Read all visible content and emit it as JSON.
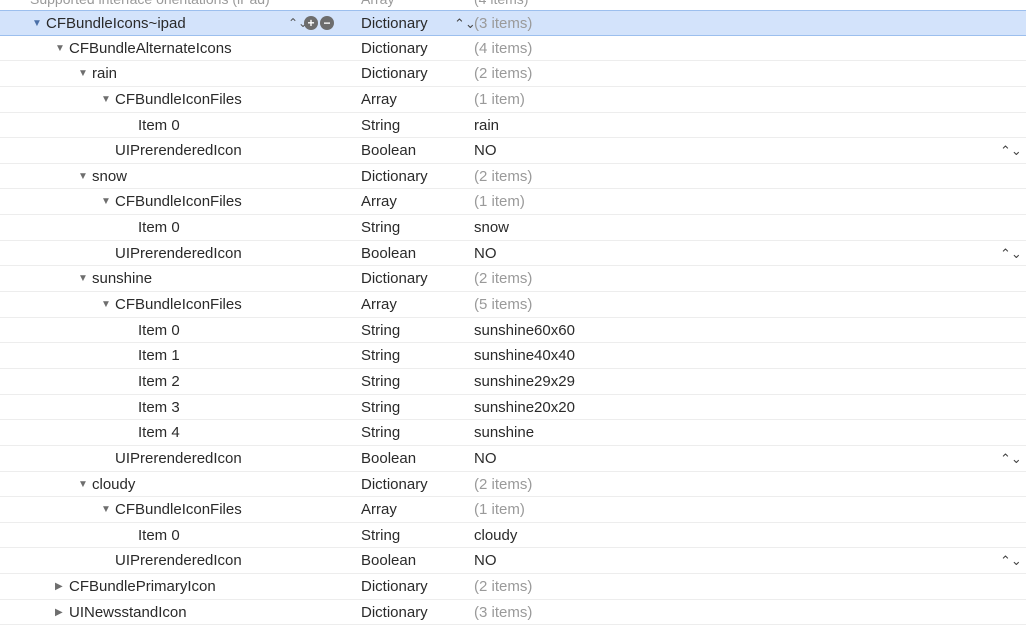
{
  "partial_row": {
    "key": "Supported interface orientations (iPad)",
    "type": "Array",
    "value": "(4 items)"
  },
  "rows": [
    {
      "key": "CFBundleIcons~ipad",
      "type": "Dictionary",
      "value": "(3 items)",
      "level": 0,
      "disclosure": "open",
      "selected": true
    },
    {
      "key": "CFBundleAlternateIcons",
      "type": "Dictionary",
      "value": "(4 items)",
      "level": 1,
      "disclosure": "open"
    },
    {
      "key": "rain",
      "type": "Dictionary",
      "value": "(2 items)",
      "level": 2,
      "disclosure": "open"
    },
    {
      "key": "CFBundleIconFiles",
      "type": "Array",
      "value": "(1 item)",
      "level": 3,
      "disclosure": "open"
    },
    {
      "key": "Item 0",
      "type": "String",
      "value": "rain",
      "level": 4,
      "disclosure": "none"
    },
    {
      "key": "UIPrerenderedIcon",
      "type": "Boolean",
      "value": "NO",
      "level": 3,
      "disclosure": "none",
      "stepper": true
    },
    {
      "key": "snow",
      "type": "Dictionary",
      "value": "(2 items)",
      "level": 2,
      "disclosure": "open"
    },
    {
      "key": "CFBundleIconFiles",
      "type": "Array",
      "value": "(1 item)",
      "level": 3,
      "disclosure": "open"
    },
    {
      "key": "Item 0",
      "type": "String",
      "value": "snow",
      "level": 4,
      "disclosure": "none"
    },
    {
      "key": "UIPrerenderedIcon",
      "type": "Boolean",
      "value": "NO",
      "level": 3,
      "disclosure": "none",
      "stepper": true
    },
    {
      "key": "sunshine",
      "type": "Dictionary",
      "value": "(2 items)",
      "level": 2,
      "disclosure": "open"
    },
    {
      "key": "CFBundleIconFiles",
      "type": "Array",
      "value": "(5 items)",
      "level": 3,
      "disclosure": "open"
    },
    {
      "key": "Item 0",
      "type": "String",
      "value": "sunshine60x60",
      "level": 4,
      "disclosure": "none"
    },
    {
      "key": "Item 1",
      "type": "String",
      "value": "sunshine40x40",
      "level": 4,
      "disclosure": "none"
    },
    {
      "key": "Item 2",
      "type": "String",
      "value": "sunshine29x29",
      "level": 4,
      "disclosure": "none"
    },
    {
      "key": "Item 3",
      "type": "String",
      "value": "sunshine20x20",
      "level": 4,
      "disclosure": "none"
    },
    {
      "key": "Item 4",
      "type": "String",
      "value": "sunshine",
      "level": 4,
      "disclosure": "none"
    },
    {
      "key": "UIPrerenderedIcon",
      "type": "Boolean",
      "value": "NO",
      "level": 3,
      "disclosure": "none",
      "stepper": true
    },
    {
      "key": "cloudy",
      "type": "Dictionary",
      "value": "(2 items)",
      "level": 2,
      "disclosure": "open"
    },
    {
      "key": "CFBundleIconFiles",
      "type": "Array",
      "value": "(1 item)",
      "level": 3,
      "disclosure": "open"
    },
    {
      "key": "Item 0",
      "type": "String",
      "value": "cloudy",
      "level": 4,
      "disclosure": "none"
    },
    {
      "key": "UIPrerenderedIcon",
      "type": "Boolean",
      "value": "NO",
      "level": 3,
      "disclosure": "none",
      "stepper": true
    },
    {
      "key": "CFBundlePrimaryIcon",
      "type": "Dictionary",
      "value": "(2 items)",
      "level": 1,
      "disclosure": "closed"
    },
    {
      "key": "UINewsstandIcon",
      "type": "Dictionary",
      "value": "(3 items)",
      "level": 1,
      "disclosure": "closed"
    }
  ],
  "icons": {
    "disclosure_open": "▼",
    "disclosure_closed": "▶",
    "stepper": "⌃⌄",
    "add": "+",
    "remove": "−"
  },
  "colors": {
    "selection": "#d3e3fb",
    "muted_text": "#9a9a9a"
  }
}
